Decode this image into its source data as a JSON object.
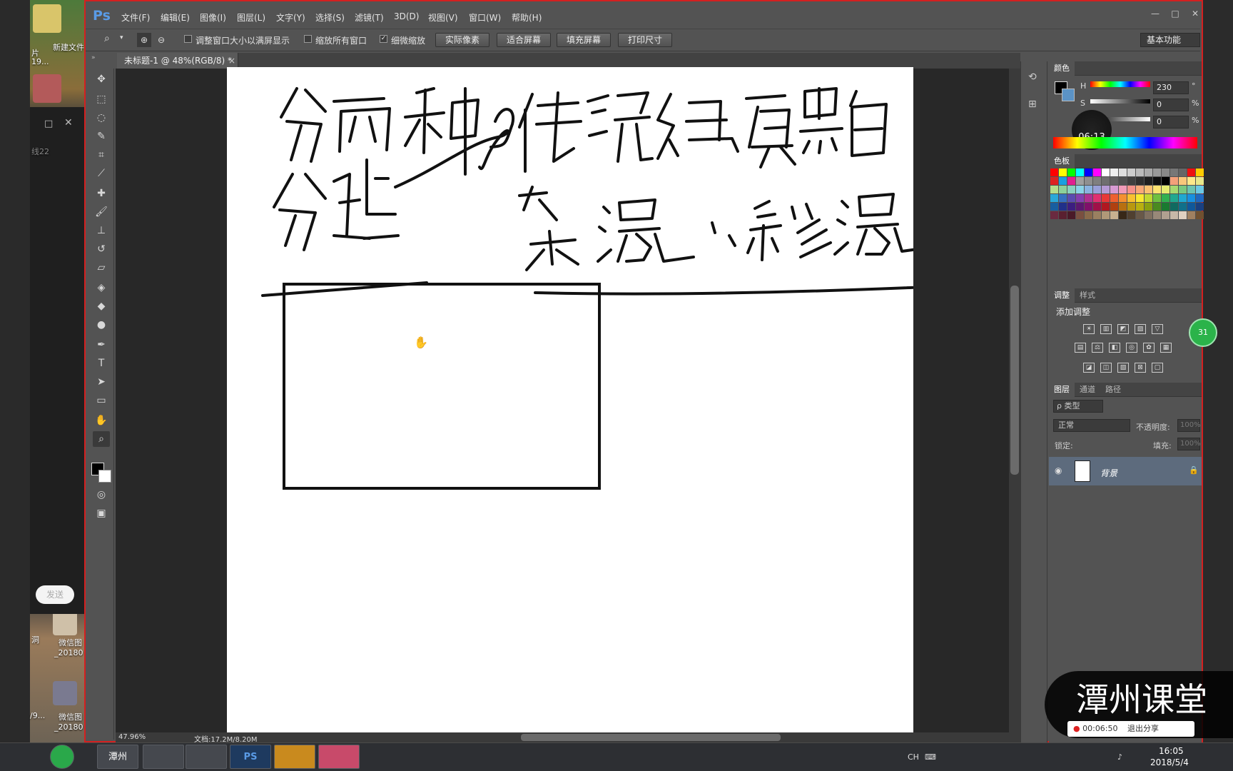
{
  "desktop": {
    "icons": [
      {
        "label": "新建文件"
      },
      {
        "label": "微信图",
        "sub": "_20180"
      },
      {
        "label": "微信图",
        "sub": "_20180"
      }
    ],
    "left_labels": [
      "片",
      "19...",
      "线22",
      "洞",
      "/9..."
    ],
    "chat_send_label": "发送"
  },
  "ps": {
    "logo": "Ps",
    "menu": [
      "文件(F)",
      "编辑(E)",
      "图像(I)",
      "图层(L)",
      "文字(Y)",
      "选择(S)",
      "滤镜(T)",
      "3D(D)",
      "视图(V)",
      "窗口(W)",
      "帮助(H)"
    ],
    "window_controls": [
      "—",
      "□",
      "✕"
    ],
    "options": {
      "check1_label": "调整窗口大小以满屏显示",
      "check2_label": "缩放所有窗口",
      "check3_label": "细微缩放",
      "check3_checked": true,
      "btn_actual": "实际像素",
      "btn_fit": "适合屏幕",
      "btn_fill": "填充屏幕",
      "btn_print": "打印尺寸",
      "workspace": "基本功能"
    },
    "tab": {
      "title": "未标题-1 @ 48%(RGB/8) *",
      "close": "×"
    },
    "status": {
      "zoom": "47.96%",
      "doc": "文档:17.2M/8.20M"
    },
    "canvas_cursor": "hand-cursor"
  },
  "panels": {
    "color": {
      "tab": "颜色",
      "h_label": "H",
      "h_value": "230",
      "h_unit": "°",
      "s_label": "S",
      "s_value": "0",
      "s_unit": "%",
      "b_value": "0",
      "b_unit": "%",
      "timer": "06:13"
    },
    "swatches": {
      "tab": "色板",
      "colors": [
        "#ff0000",
        "#ffff00",
        "#00ff00",
        "#00ffff",
        "#0000ff",
        "#ff00ff",
        "#ffffff",
        "#eeeeee",
        "#dddddd",
        "#cccccc",
        "#bbbbbb",
        "#aaaaaa",
        "#999999",
        "#888888",
        "#777777",
        "#666666",
        "#ee1111",
        "#ffcc00",
        "#dd2222",
        "#1a9fe0",
        "#e02090",
        "#a0a0a0",
        "#8f8f8f",
        "#7f7f7f",
        "#6f6f6f",
        "#5f5f5f",
        "#4f4f4f",
        "#3f3f3f",
        "#2f2f2f",
        "#1f1f1f",
        "#0f0f0f",
        "#000000",
        "#f4a07a",
        "#f9c77b",
        "#fde88a",
        "#e8e88a",
        "#b4dd8c",
        "#8cd19a",
        "#8ad1c0",
        "#8ad4e8",
        "#8ab3e0",
        "#9aa0d8",
        "#b69ad4",
        "#d79ad2",
        "#f09ab8",
        "#f5918a",
        "#f8a878",
        "#fbc070",
        "#fce270",
        "#e4ea70",
        "#a6d870",
        "#78c880",
        "#6cc4b0",
        "#6cc8e4",
        "#2aa8d8",
        "#3670c0",
        "#5a4cb0",
        "#8440b0",
        "#b03090",
        "#e03070",
        "#e83838",
        "#ee6030",
        "#f49030",
        "#f8c030",
        "#f8e830",
        "#c0d830",
        "#70c040",
        "#30b050",
        "#20a890",
        "#20a8d0",
        "#1890e0",
        "#2068c0",
        "#185ea0",
        "#20308a",
        "#3c1e80",
        "#5c1870",
        "#80106a",
        "#a01048",
        "#b01820",
        "#b04010",
        "#b87010",
        "#b89810",
        "#b8b010",
        "#8aa010",
        "#4a8a20",
        "#1a7a30",
        "#106a60",
        "#10708a",
        "#10589a",
        "#1a4080",
        "#6a2a40",
        "#5a2030",
        "#4a1a28",
        "#7a5040",
        "#8a6a4a",
        "#9a8060",
        "#b09878",
        "#c8b090",
        "#382818",
        "#504030",
        "#685848",
        "#807060",
        "#988878",
        "#b0a090",
        "#c8b8a8",
        "#e0d0c0",
        "#a08060",
        "#705030"
      ]
    },
    "adjustments": {
      "tab": "调整",
      "tab2": "样式",
      "title": "添加调整",
      "row1": [
        "☀",
        "▥",
        "◩",
        "▨",
        "▽"
      ],
      "row2": [
        "▤",
        "⚖",
        "◧",
        "◎",
        "✿",
        "▦"
      ],
      "row3": [
        "◪",
        "◫",
        "▧",
        "⊠",
        "▢"
      ],
      "badge": "31"
    },
    "layers": {
      "tab1": "图层",
      "tab2": "通道",
      "tab3": "路径",
      "filter": "ρ 类型",
      "blend": "正常",
      "opacity_label": "不透明度:",
      "opacity_value": "100%",
      "lock_label": "锁定:",
      "fill_label": "填充:",
      "fill_value": "100%",
      "layer_name": "背景"
    }
  },
  "watermark": {
    "text": "潭州课堂",
    "rec_time": "00:06:50",
    "exit": "退出分享"
  },
  "taskbar": {
    "buttons": [
      "潭州",
      "PS",
      ""
    ],
    "tray": [
      "CH",
      "⌨",
      "♪"
    ],
    "time": "16:05",
    "date": "2018/5/4"
  }
}
